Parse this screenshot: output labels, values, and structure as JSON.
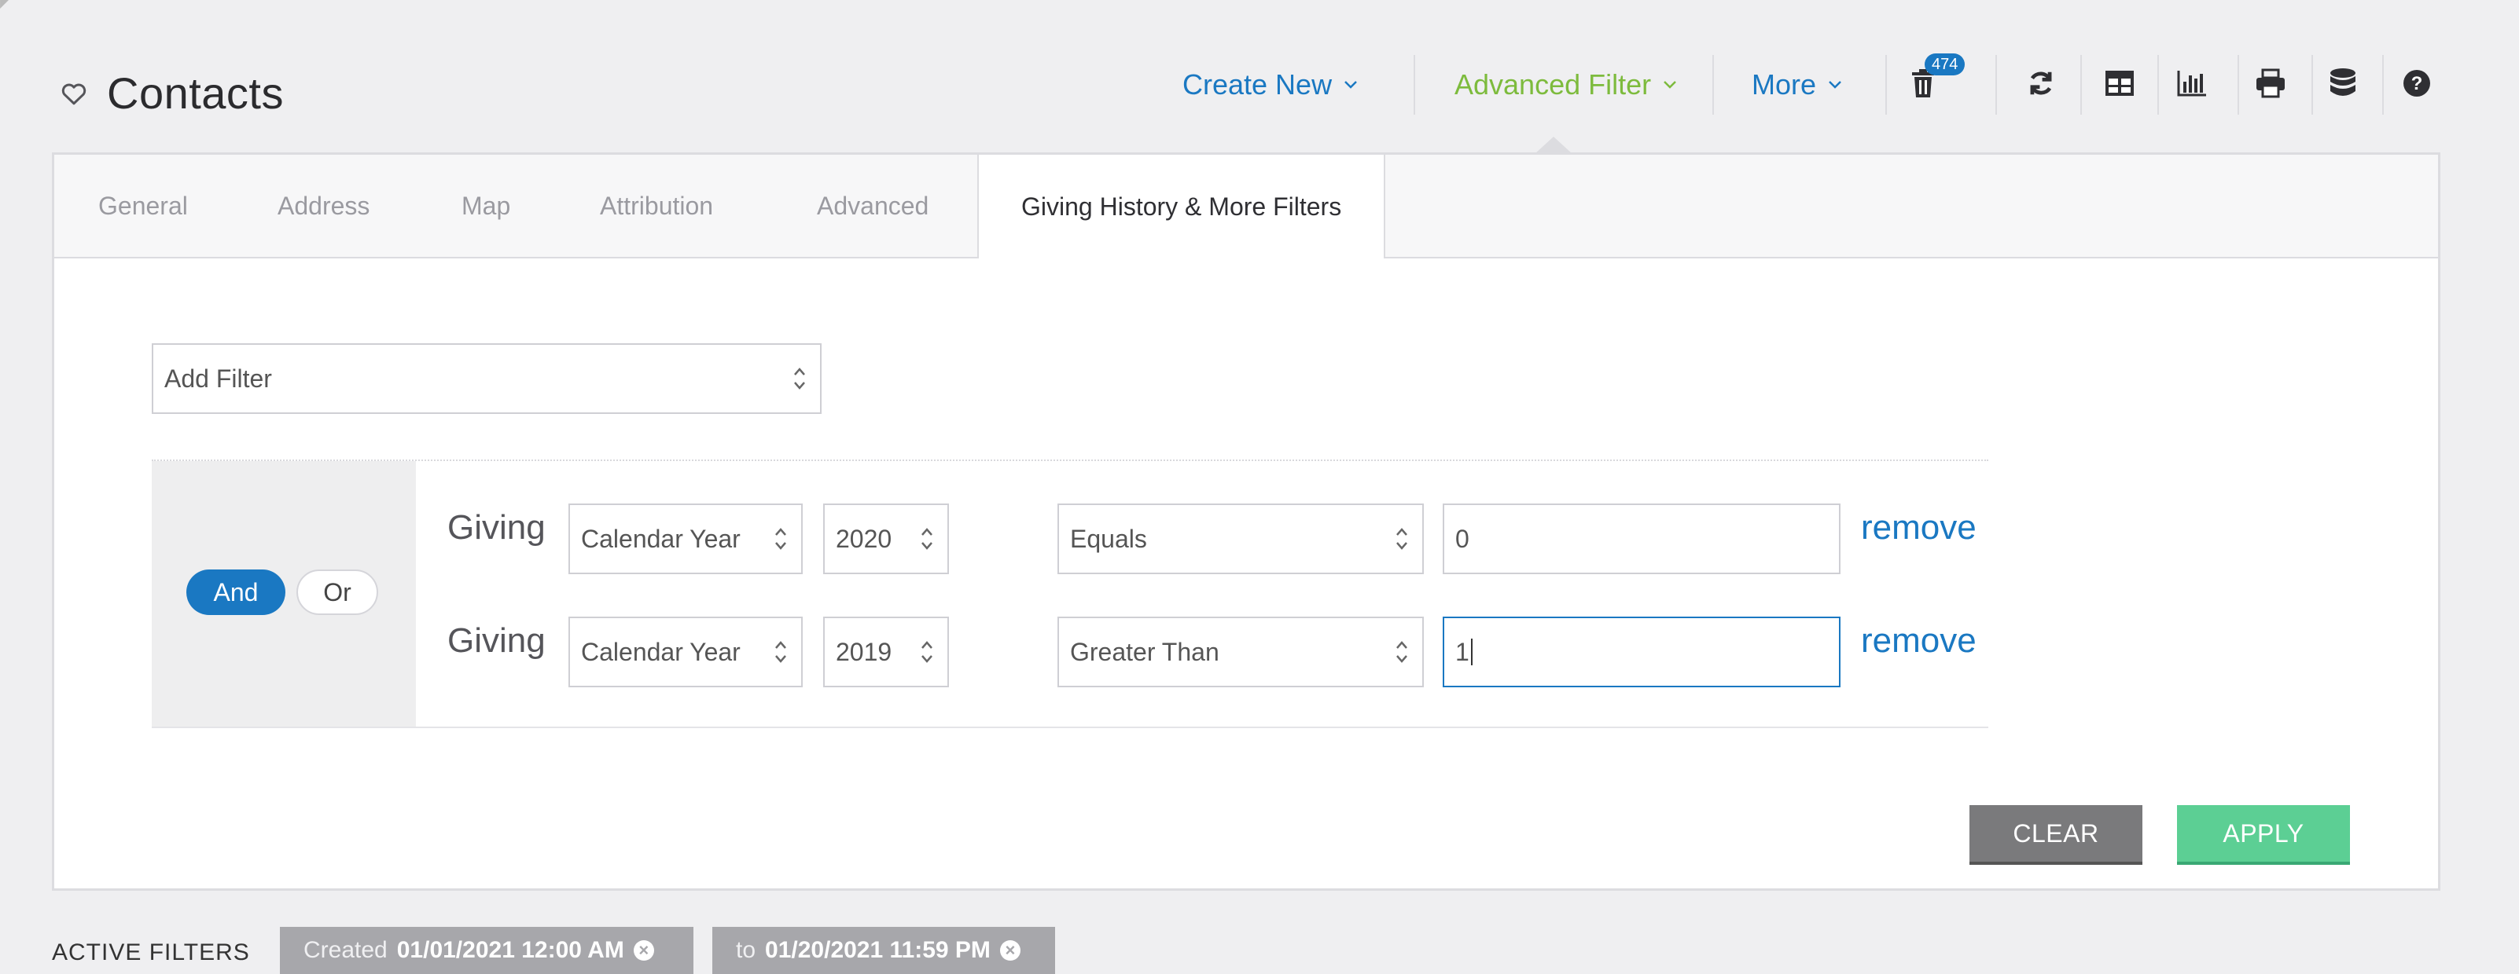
{
  "page": {
    "title": "Contacts"
  },
  "toolbar": {
    "create_new": "Create New",
    "advanced_filter": "Advanced Filter",
    "more": "More",
    "trash_badge": "474",
    "colors": {
      "link": "#1a78c2",
      "active": "#7dbb3d"
    }
  },
  "tabs": [
    {
      "label": "General"
    },
    {
      "label": "Address"
    },
    {
      "label": "Map"
    },
    {
      "label": "Attribution"
    },
    {
      "label": "Advanced"
    },
    {
      "label": "Giving History & More Filters",
      "active": true
    }
  ],
  "add_filter": {
    "placeholder": "Add Filter"
  },
  "logic": {
    "and_label": "And",
    "or_label": "Or",
    "selected": "And"
  },
  "filters": [
    {
      "label": "Giving",
      "period": "Calendar Year",
      "year": "2020",
      "operator": "Equals",
      "value": "0",
      "remove": "remove"
    },
    {
      "label": "Giving",
      "period": "Calendar Year",
      "year": "2019",
      "operator": "Greater Than",
      "value": "1",
      "remove": "remove"
    }
  ],
  "buttons": {
    "clear": "CLEAR",
    "apply": "APPLY"
  },
  "active_filters": {
    "label": "ACTIVE FILTERS",
    "chips": [
      {
        "key": "Created",
        "value": "01/01/2021 12:00 AM"
      },
      {
        "key": "to",
        "value": "01/20/2021 11:59 PM"
      }
    ]
  }
}
